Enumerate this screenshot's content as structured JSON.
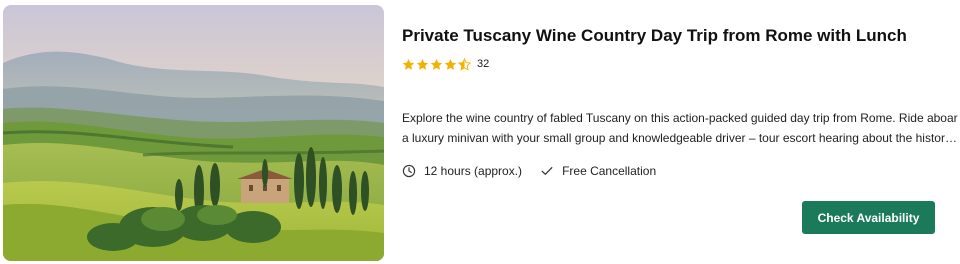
{
  "listing": {
    "title": "Private Tuscany Wine Country Day Trip from Rome with Lunch",
    "rating_value": 4.5,
    "review_count": "32",
    "description_line1": "Explore the wine country of fabled Tuscany on this action-packed guided day trip from Rome. Ride aboard",
    "description_line2": "a luxury minivan with your small group and knowledgeable driver – tour escort hearing about the history o...",
    "duration": "12 hours (approx.)",
    "cancellation": "Free Cancellation",
    "cta_label": "Check Availability"
  },
  "icons": {
    "rating": "star-icon",
    "duration": "clock-icon",
    "cancellation": "check-icon"
  },
  "colors": {
    "star": "#f2b203",
    "cta_background": "#1a7a5a",
    "cta_text": "#ffffff",
    "title": "#111111"
  }
}
